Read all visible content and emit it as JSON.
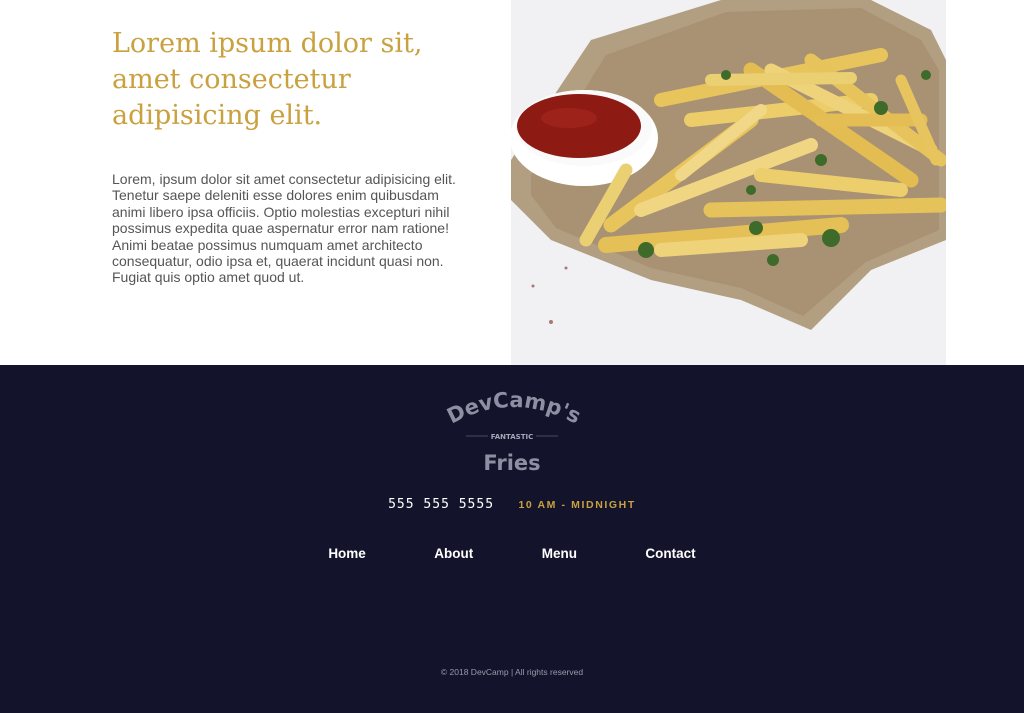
{
  "hero": {
    "heading": "Lorem ipsum dolor sit, amet consectetur adipisicing elit.",
    "body": "Lorem, ipsum dolor sit amet consectetur adipisicing elit. Tenetur saepe deleniti esse dolores enim quibusdam animi libero ipsa officiis. Optio molestias excepturi nihil possimus expedita quae aspernatur error nam ratione! Animi beatae possimus numquam amet architecto consequatur, odio ipsa et, quaerat incidunt quasi non. Fugiat quis optio amet quod ut."
  },
  "logo": {
    "top_text": "DevCamp's",
    "middle_text": "FANTASTIC",
    "bottom_text": "Fries"
  },
  "contact": {
    "phone": "555 555 5555",
    "hours": "10 AM - MIDNIGHT"
  },
  "nav": {
    "items": [
      "Home",
      "About",
      "Menu",
      "Contact"
    ]
  },
  "footer": {
    "copyright": "© 2018 DevCamp | All rights reserved"
  },
  "colors": {
    "accent": "#c9a13f",
    "footer_bg": "#13132b"
  },
  "image": {
    "icon": "fries-photo"
  }
}
